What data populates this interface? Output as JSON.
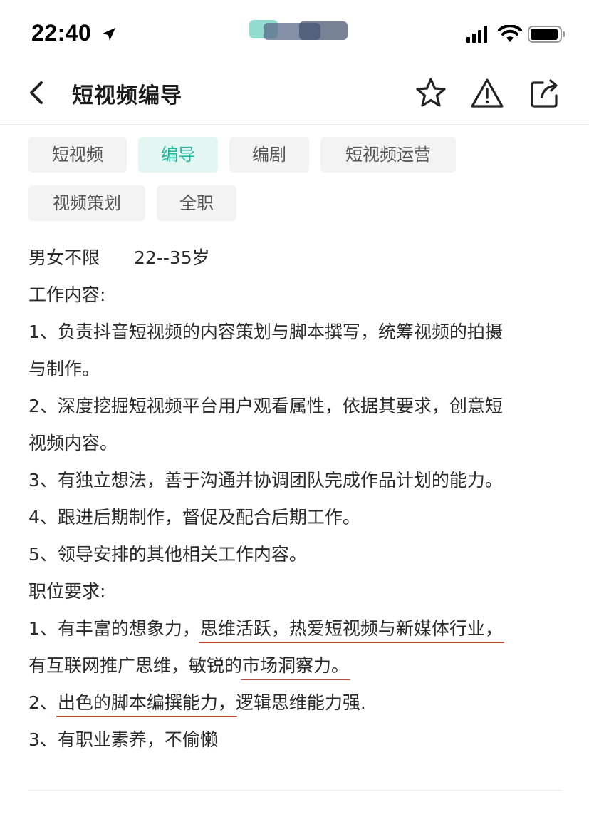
{
  "status_bar": {
    "time": "22:40",
    "location_icon": "location-arrow-icon",
    "carrier_icon": "carrier-blurred-icon",
    "signal_icon": "cellular-signal-icon",
    "wifi_icon": "wifi-icon",
    "battery_icon": "battery-icon"
  },
  "header": {
    "title": "短视频编导",
    "back_icon": "chevron-left-icon",
    "star_icon": "star-outline-icon",
    "report_icon": "warning-triangle-icon",
    "share_icon": "share-icon"
  },
  "tags": [
    {
      "label": "短视频",
      "active": false
    },
    {
      "label": "编导",
      "active": true
    },
    {
      "label": "编剧",
      "active": false
    },
    {
      "label": "短视频运营",
      "active": false
    },
    {
      "label": "视频策划",
      "active": false
    },
    {
      "label": "全职",
      "active": false
    }
  ],
  "colors": {
    "accent": "#1fb89a",
    "accent_bg": "#e3f6f2",
    "tag_bg": "#f3f3f3",
    "underline": "#c84a3a"
  },
  "description": {
    "gender": "男女不限",
    "age": "22--35岁",
    "work_heading": "工作内容:",
    "work_1a": "1、负责抖音短视频的内容策划与脚本撰写，统筹视频的拍摄",
    "work_1b": "与制作。",
    "work_2a": "2、深度挖掘短视频平台用户观看属性，依据其要求，创意短",
    "work_2b": "视频内容。",
    "work_3": "3、有独立想法，善于沟通并协调团队完成作品计划的能力。",
    "work_4": "4、跟进后期制作，督促及配合后期工作。",
    "work_5": "5、领导安排的其他相关工作内容。",
    "req_heading": "职位要求:",
    "req_1a_prefix": "1、有丰富的想象力，",
    "req_1a_underlined": "思维活跃，热爱短视频与新媒体行业，",
    "req_1b_prefix": "有互联网推广思维，敏锐的",
    "req_1b_underlined": "市场洞察力。",
    "req_2_prefix": "2、",
    "req_2_underlined": "出色的脚本编撰能力，",
    "req_2_suffix": "逻辑思维能力强.",
    "req_3": "3、有职业素养，不偷懒"
  }
}
